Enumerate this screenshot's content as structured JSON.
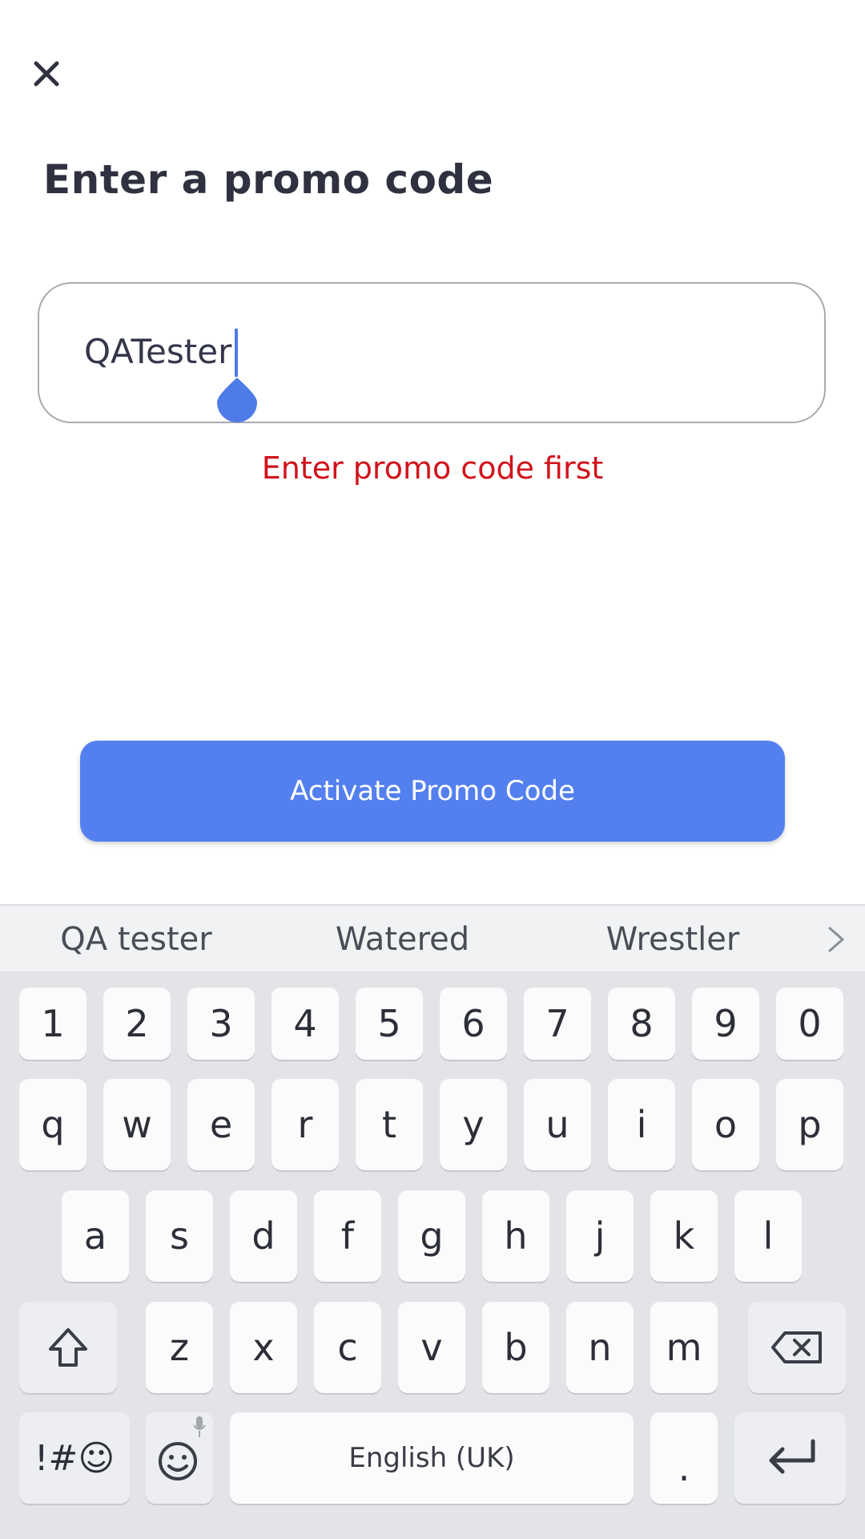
{
  "dialog": {
    "title": "Enter a promo code",
    "close_icon": "close-icon"
  },
  "promo_field": {
    "value": "QATester",
    "error": "Enter promo code first"
  },
  "activate_button": {
    "label": "Activate Promo Code"
  },
  "colors": {
    "accent": "#5480ef",
    "error": "#d1131b",
    "text": "#2f3140"
  },
  "keyboard": {
    "suggestions": [
      "QA tester",
      "Watered",
      "Wrestler"
    ],
    "suggestion_more_icon": "chevron-right-icon",
    "number_row": [
      "1",
      "2",
      "3",
      "4",
      "5",
      "6",
      "7",
      "8",
      "9",
      "0"
    ],
    "row1": [
      "q",
      "w",
      "e",
      "r",
      "t",
      "y",
      "u",
      "i",
      "o",
      "p"
    ],
    "row2": [
      "a",
      "s",
      "d",
      "f",
      "g",
      "h",
      "j",
      "k",
      "l"
    ],
    "row3": [
      "z",
      "x",
      "c",
      "v",
      "b",
      "n",
      "m"
    ],
    "symbols_key": "!#☺",
    "space_label": "English (UK)",
    "period_key": "."
  }
}
